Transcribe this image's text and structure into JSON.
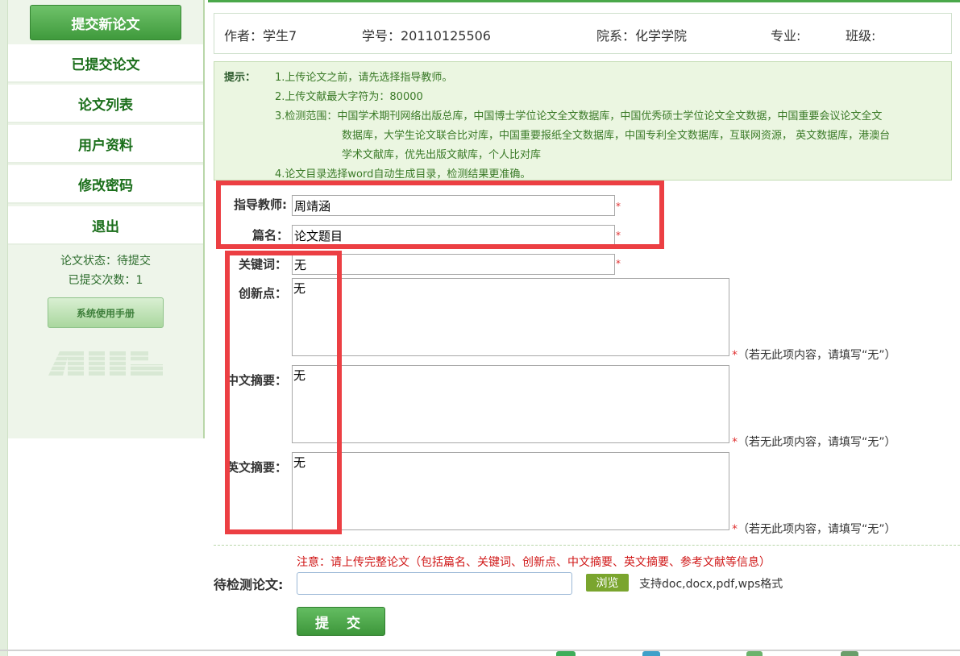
{
  "sidebar": {
    "active_item": "提交新论文",
    "items": [
      "已提交论文",
      "论文列表",
      "用户资料",
      "修改密码",
      "退出"
    ],
    "status_label": "论文状态：",
    "status_value": "待提交",
    "count_label": "已提交次数：",
    "count_value": "1",
    "manual_button": "系统使用手册"
  },
  "header": {
    "author": "作者：学生7",
    "student_id": "学号：20110125506",
    "department": "院系：化学学院",
    "major": "专业:",
    "class": "班级:"
  },
  "hint": {
    "label": "提示：",
    "lines": [
      "1.上传论文之前，请先选择指导教师。",
      "2.上传文献最大字符为：80000",
      "3.检测范围：中国学术期刊网络出版总库，中国博士学位论文全文数据库，中国优秀硕士学位论文全文数据，中国重要会议论文全文",
      "数据库，大学生论文联合比对库，中国重要报纸全文数据库，中国专利全文数据库，互联网资源， 英文数据库，港澳台",
      "学术文献库，优先出版文献库，个人比对库",
      "4.论文目录选择word自动生成目录，检测结果更准确。"
    ]
  },
  "form": {
    "advisor_label": "指导教师:",
    "advisor_value": "周靖涵",
    "title_label": "篇名：",
    "title_value": "论文题目",
    "keywords_label": "关键词：",
    "keywords_value": "无",
    "innovation_label": "创新点：",
    "innovation_value": "无",
    "cn_abstract_label": "中文摘要：",
    "cn_abstract_value": "无",
    "en_abstract_label": "英文摘要：",
    "en_abstract_value": "无",
    "required_mark": "*",
    "fill_note": "（若无此项内容，请填写“无”）"
  },
  "upload": {
    "warning": "注意：请上传完整论文（包括篇名、关键词、创新点、中文摘要、英文摘要、参考文献等信息）",
    "label": "待检测论文:",
    "browse_button": "浏览",
    "formats": "支持doc,docx,pdf,wps格式",
    "submit_button": "提 交"
  },
  "colors": {
    "accent_green": "#4aa84a",
    "highlight_red": "#ec3f43",
    "hint_bg": "#ebf6e1"
  }
}
